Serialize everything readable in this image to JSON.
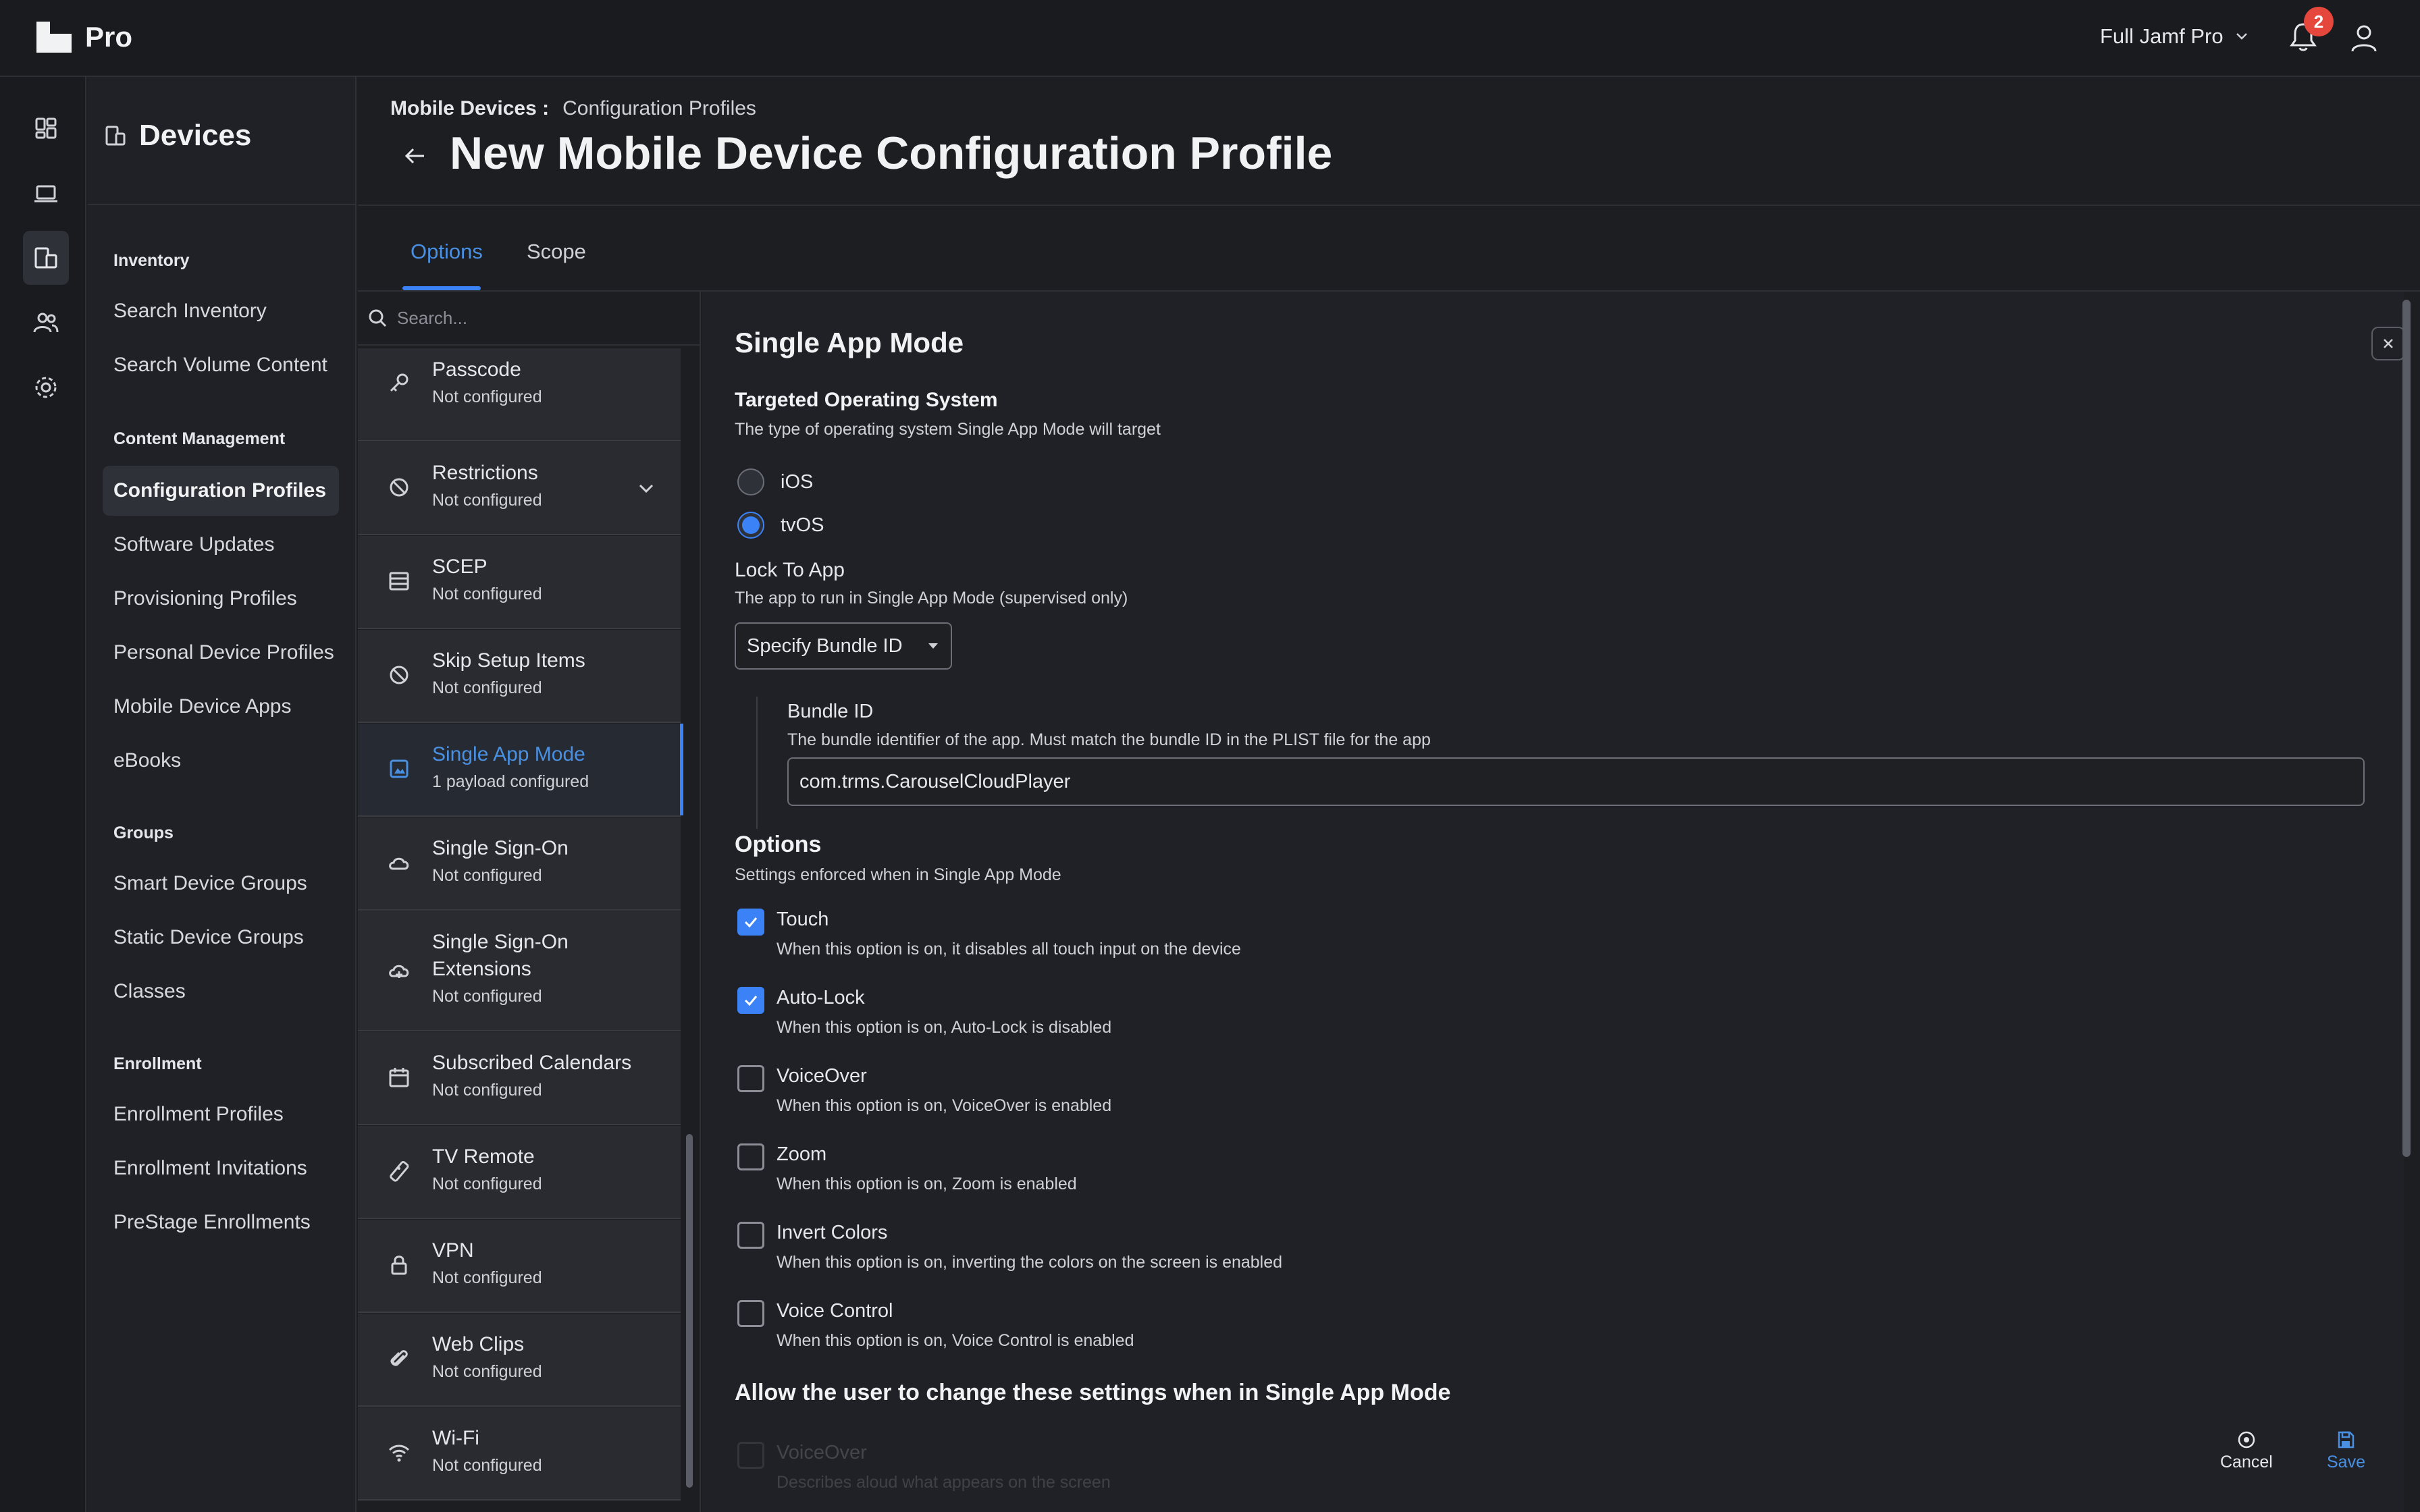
{
  "app": {
    "title": "Pro",
    "environment": "Full Jamf Pro",
    "notifications_count": "2"
  },
  "rail": {
    "icons": [
      "dashboard-icon",
      "computers-icon",
      "mobile-devices-icon",
      "users-icon",
      "settings-icon"
    ]
  },
  "sidebar": {
    "title": "Devices",
    "groups": [
      {
        "label": "Inventory",
        "items": [
          "Search Inventory",
          "Search Volume Content"
        ]
      },
      {
        "label": "Content Management",
        "items": [
          "Configuration Profiles",
          "Software Updates",
          "Provisioning Profiles",
          "Personal Device Profiles",
          "Mobile Device Apps",
          "eBooks"
        ]
      },
      {
        "label": "Groups",
        "items": [
          "Smart Device Groups",
          "Static Device Groups",
          "Classes"
        ]
      },
      {
        "label": "Enrollment",
        "items": [
          "Enrollment Profiles",
          "Enrollment Invitations",
          "PreStage Enrollments"
        ]
      }
    ],
    "active_item": "Configuration Profiles"
  },
  "header": {
    "breadcrumb_root": "Mobile Devices",
    "breadcrumb_sep": ":",
    "breadcrumb_current": "Configuration Profiles",
    "title": "New Mobile Device Configuration Profile"
  },
  "tabs": [
    {
      "label": "Options"
    },
    {
      "label": "Scope"
    }
  ],
  "payload_list": {
    "search_placeholder": "Search...",
    "items": [
      {
        "name": "Passcode",
        "status": "Not configured",
        "icon": "key-icon"
      },
      {
        "name": "Restrictions",
        "status": "Not configured",
        "icon": "restrict-icon"
      },
      {
        "name": "SCEP",
        "status": "Not configured",
        "icon": "certificate-icon"
      },
      {
        "name": "Skip Setup Items",
        "status": "Not configured",
        "icon": "skip-icon"
      },
      {
        "name": "Single App Mode",
        "status": "1 payload configured",
        "icon": "single-app-icon"
      },
      {
        "name": "Single Sign-On",
        "status": "Not configured",
        "icon": "cloud-icon"
      },
      {
        "name": "Single Sign-On Extensions",
        "status": "Not configured",
        "icon": "cloud-extension-icon"
      },
      {
        "name": "Subscribed Calendars",
        "status": "Not configured",
        "icon": "calendar-icon"
      },
      {
        "name": "TV Remote",
        "status": "Not configured",
        "icon": "remote-icon"
      },
      {
        "name": "VPN",
        "status": "Not configured",
        "icon": "lock-icon"
      },
      {
        "name": "Web Clips",
        "status": "Not configured",
        "icon": "paperclip-icon"
      },
      {
        "name": "Wi-Fi",
        "status": "Not configured",
        "icon": "wifi-icon"
      }
    ]
  },
  "detail": {
    "title": "Single App Mode",
    "targeted_os": {
      "label": "Targeted Operating System",
      "description": "The type of operating system Single App Mode will target",
      "options": [
        "iOS",
        "tvOS"
      ],
      "selected": "tvOS"
    },
    "lock_to_app": {
      "label": "Lock To App",
      "description": "The app to run in Single App Mode (supervised only)",
      "value": "Specify Bundle ID"
    },
    "bundle_id": {
      "label": "Bundle ID",
      "description": "The bundle identifier of the app. Must match the bundle ID in the PLIST file for the app",
      "value": "com.trms.CarouselCloudPlayer"
    },
    "options": {
      "label": "Options",
      "description": "Settings enforced when in Single App Mode",
      "items": [
        {
          "name": "Touch",
          "description": "When this option is on, it disables all touch input on the device",
          "checked": true
        },
        {
          "name": "Auto-Lock",
          "description": "When this option is on, Auto-Lock is disabled",
          "checked": true
        },
        {
          "name": "VoiceOver",
          "description": "When this option is on, VoiceOver is enabled",
          "checked": false
        },
        {
          "name": "Zoom",
          "description": "When this option is on, Zoom is enabled",
          "checked": false
        },
        {
          "name": "Invert Colors",
          "description": "When this option is on, inverting the colors on the screen is enabled",
          "checked": false
        },
        {
          "name": "Voice Control",
          "description": "When this option is on, Voice Control is enabled",
          "checked": false
        }
      ]
    },
    "user_allowed": {
      "label": "Allow the user to change these settings when in Single App Mode",
      "items": [
        {
          "name": "VoiceOver",
          "description": "Describes aloud what appears on the screen",
          "checked": false
        }
      ]
    }
  },
  "footer": {
    "cancel_label": "Cancel",
    "save_label": "Save"
  },
  "colors": {
    "accent": "#3b82f6",
    "link": "#4a90e2",
    "badge": "#e5473c",
    "background": "#1d1e22"
  }
}
